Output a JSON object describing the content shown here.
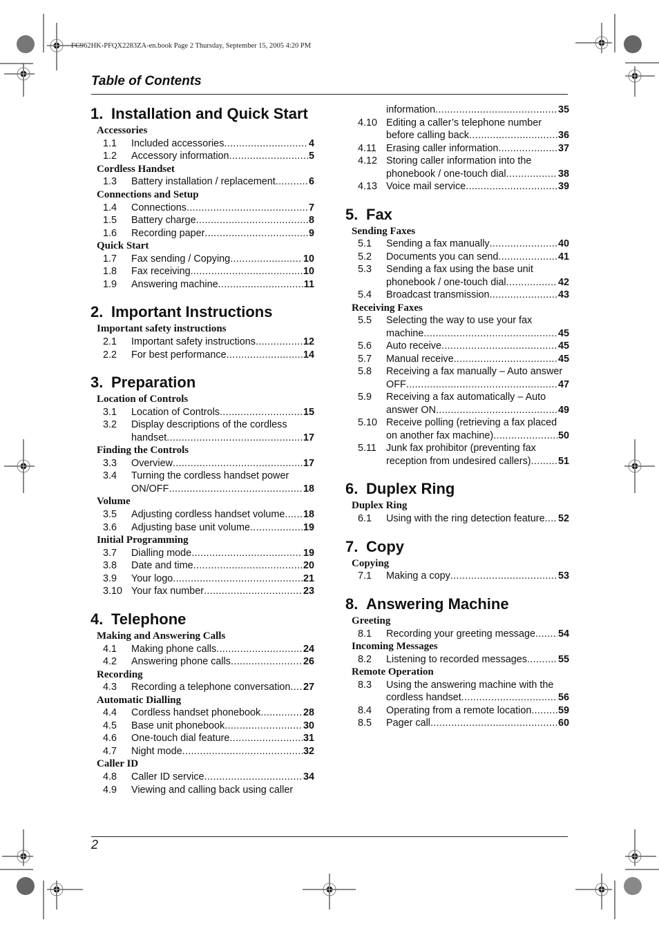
{
  "print_slug": "FC962HK-PFQX2283ZA-en.book  Page 2  Thursday, September 15, 2005  4:20 PM",
  "header": {
    "title": "Table of Contents"
  },
  "footer": {
    "page_number": "2"
  },
  "chapters": [
    {
      "number": "1.",
      "title": "Installation and Quick Start",
      "groups": [
        {
          "title": "Accessories",
          "entries": [
            {
              "no": "1.1",
              "lines": [
                "Included accessories"
              ],
              "page": "4"
            },
            {
              "no": "1.2",
              "lines": [
                "Accessory information"
              ],
              "page": "5"
            }
          ]
        },
        {
          "title": "Cordless Handset",
          "entries": [
            {
              "no": "1.3",
              "lines": [
                "Battery installation / replacement"
              ],
              "page": "6"
            }
          ]
        },
        {
          "title": "Connections and Setup",
          "entries": [
            {
              "no": "1.4",
              "lines": [
                "Connections"
              ],
              "page": "7"
            },
            {
              "no": "1.5",
              "lines": [
                "Battery charge"
              ],
              "page": "8"
            },
            {
              "no": "1.6",
              "lines": [
                "Recording paper"
              ],
              "page": "9"
            }
          ]
        },
        {
          "title": "Quick Start",
          "entries": [
            {
              "no": "1.7",
              "lines": [
                "Fax sending / Copying"
              ],
              "page": "10"
            },
            {
              "no": "1.8",
              "lines": [
                "Fax receiving"
              ],
              "page": "10"
            },
            {
              "no": "1.9",
              "lines": [
                "Answering machine"
              ],
              "page": "11"
            }
          ]
        }
      ]
    },
    {
      "number": "2.",
      "title": "Important Instructions",
      "groups": [
        {
          "title": "Important safety instructions",
          "entries": [
            {
              "no": "2.1",
              "lines": [
                "Important safety instructions"
              ],
              "page": "12"
            },
            {
              "no": "2.2",
              "lines": [
                "For best performance"
              ],
              "page": "14"
            }
          ]
        }
      ]
    },
    {
      "number": "3.",
      "title": "Preparation",
      "groups": [
        {
          "title": "Location of Controls",
          "entries": [
            {
              "no": "3.1",
              "lines": [
                "Location of Controls"
              ],
              "page": "15"
            },
            {
              "no": "3.2",
              "lines": [
                "Display descriptions of the cordless",
                "handset"
              ],
              "page": "17"
            }
          ]
        },
        {
          "title": "Finding the Controls",
          "entries": [
            {
              "no": "3.3",
              "lines": [
                "Overview"
              ],
              "page": "17"
            },
            {
              "no": "3.4",
              "lines": [
                "Turning the cordless handset power",
                "ON/OFF"
              ],
              "page": "18"
            }
          ]
        },
        {
          "title": "Volume",
          "entries": [
            {
              "no": "3.5",
              "lines": [
                "Adjusting cordless handset volume"
              ],
              "page": "18"
            },
            {
              "no": "3.6",
              "lines": [
                "Adjusting base unit volume"
              ],
              "page": "19"
            }
          ]
        },
        {
          "title": "Initial Programming",
          "entries": [
            {
              "no": "3.7",
              "lines": [
                "Dialling mode"
              ],
              "page": "19"
            },
            {
              "no": "3.8",
              "lines": [
                "Date and time"
              ],
              "page": "20"
            },
            {
              "no": "3.9",
              "lines": [
                "Your logo"
              ],
              "page": "21"
            },
            {
              "no": "3.10",
              "lines": [
                "Your fax number"
              ],
              "page": "23"
            }
          ]
        }
      ]
    },
    {
      "number": "4.",
      "title": "Telephone",
      "groups": [
        {
          "title": "Making and Answering Calls",
          "entries": [
            {
              "no": "4.1",
              "lines": [
                "Making phone calls"
              ],
              "page": "24"
            },
            {
              "no": "4.2",
              "lines": [
                "Answering phone calls"
              ],
              "page": "26"
            }
          ]
        },
        {
          "title": "Recording",
          "entries": [
            {
              "no": "4.3",
              "lines": [
                "Recording a telephone conversation"
              ],
              "page": "27"
            }
          ]
        },
        {
          "title": "Automatic Dialling",
          "entries": [
            {
              "no": "4.4",
              "lines": [
                "Cordless handset phonebook"
              ],
              "page": "28"
            },
            {
              "no": "4.5",
              "lines": [
                "Base unit phonebook"
              ],
              "page": "30"
            },
            {
              "no": "4.6",
              "lines": [
                "One-touch dial feature"
              ],
              "page": "31"
            },
            {
              "no": "4.7",
              "lines": [
                "Night mode"
              ],
              "page": "32"
            }
          ]
        },
        {
          "title": "Caller ID",
          "entries": [
            {
              "no": "4.8",
              "lines": [
                "Caller ID service"
              ],
              "page": "34"
            },
            {
              "no": "4.9",
              "lines": [
                "Viewing and calling back using caller",
                "information"
              ],
              "page": "35"
            },
            {
              "no": "4.10",
              "lines": [
                "Editing a caller’s telephone number",
                "before calling back"
              ],
              "page": "36"
            },
            {
              "no": "4.11",
              "lines": [
                "Erasing caller information"
              ],
              "page": "37"
            },
            {
              "no": "4.12",
              "lines": [
                "Storing caller information into the",
                "phonebook / one-touch dial"
              ],
              "page": "38"
            },
            {
              "no": "4.13",
              "lines": [
                "Voice mail service"
              ],
              "page": "39"
            }
          ]
        }
      ]
    },
    {
      "number": "5.",
      "title": "Fax",
      "groups": [
        {
          "title": "Sending Faxes",
          "entries": [
            {
              "no": "5.1",
              "lines": [
                "Sending a fax manually"
              ],
              "page": "40"
            },
            {
              "no": "5.2",
              "lines": [
                "Documents you can send"
              ],
              "page": "41"
            },
            {
              "no": "5.3",
              "lines": [
                "Sending a fax using the base unit",
                "phonebook / one-touch dial"
              ],
              "page": "42"
            },
            {
              "no": "5.4",
              "lines": [
                "Broadcast transmission"
              ],
              "page": "43"
            }
          ]
        },
        {
          "title": "Receiving Faxes",
          "entries": [
            {
              "no": "5.5",
              "lines": [
                "Selecting the way to use your fax",
                "machine"
              ],
              "page": "45"
            },
            {
              "no": "5.6",
              "lines": [
                "Auto receive"
              ],
              "page": "45"
            },
            {
              "no": "5.7",
              "lines": [
                "Manual receive"
              ],
              "page": "45"
            },
            {
              "no": "5.8",
              "lines": [
                "Receiving a fax manually – Auto answer",
                "OFF"
              ],
              "page": "47"
            },
            {
              "no": "5.9",
              "lines": [
                "Receiving a fax automatically – Auto",
                "answer ON"
              ],
              "page": "49"
            },
            {
              "no": "5.10",
              "lines": [
                "Receive polling (retrieving a fax placed",
                "on another fax machine)"
              ],
              "page": "50"
            },
            {
              "no": "5.11",
              "lines": [
                "Junk fax prohibitor (preventing fax",
                "reception from undesired callers)"
              ],
              "page": "51"
            }
          ]
        }
      ]
    },
    {
      "number": "6.",
      "title": "Duplex Ring",
      "groups": [
        {
          "title": "Duplex Ring",
          "entries": [
            {
              "no": "6.1",
              "lines": [
                "Using with the ring detection feature"
              ],
              "page": "52"
            }
          ]
        }
      ]
    },
    {
      "number": "7.",
      "title": "Copy",
      "groups": [
        {
          "title": "Copying",
          "entries": [
            {
              "no": "7.1",
              "lines": [
                "Making a copy"
              ],
              "page": "53"
            }
          ]
        }
      ]
    },
    {
      "number": "8.",
      "title": "Answering Machine",
      "groups": [
        {
          "title": "Greeting",
          "entries": [
            {
              "no": "8.1",
              "lines": [
                "Recording your greeting message"
              ],
              "page": "54"
            }
          ]
        },
        {
          "title": "Incoming Messages",
          "entries": [
            {
              "no": "8.2",
              "lines": [
                "Listening to recorded messages"
              ],
              "page": "55"
            }
          ]
        },
        {
          "title": "Remote Operation",
          "entries": [
            {
              "no": "8.3",
              "lines": [
                "Using the answering machine with the",
                "cordless handset"
              ],
              "page": "56"
            },
            {
              "no": "8.4",
              "lines": [
                "Operating from a remote location"
              ],
              "page": "59"
            },
            {
              "no": "8.5",
              "lines": [
                "Pager call"
              ],
              "page": "60"
            }
          ]
        }
      ]
    }
  ]
}
